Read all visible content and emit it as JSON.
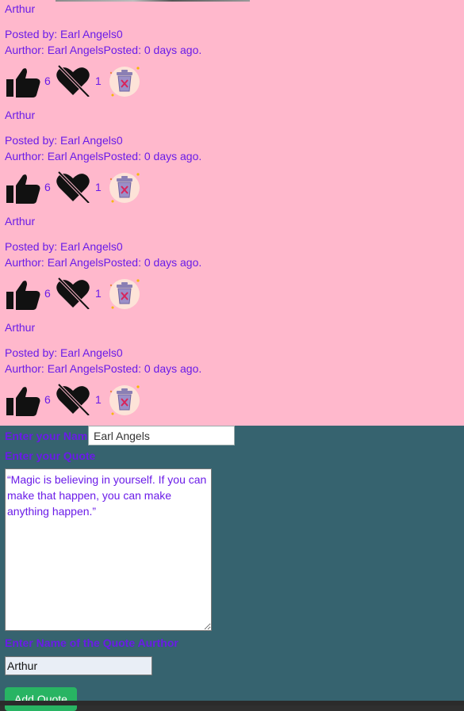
{
  "quotes": [
    {
      "author_label": "Arthur",
      "posted_by": "Posted by: Earl Angels0",
      "meta": "Aurthor: Earl AngelsPosted: 0 days ago.",
      "likes": "6",
      "dislikes": "1"
    },
    {
      "author_label": "Arthur",
      "posted_by": "Posted by: Earl Angels0",
      "meta": "Aurthor: Earl AngelsPosted: 0 days ago.",
      "likes": "6",
      "dislikes": "1"
    },
    {
      "author_label": "Arthur",
      "posted_by": "Posted by: Earl Angels0",
      "meta": "Aurthor: Earl AngelsPosted: 0 days ago.",
      "likes": "6",
      "dislikes": "1"
    },
    {
      "author_label": "Arthur",
      "posted_by": "Posted by: Earl Angels0",
      "meta": "Aurthor: Earl AngelsPosted: 0 days ago.",
      "likes": "6",
      "dislikes": "1"
    }
  ],
  "icons": {
    "like": "thumbs-up-icon",
    "dislike": "heart-off-icon",
    "delete": "trash-icon"
  },
  "form": {
    "name_label": "Enter your Name",
    "name_value": "Earl Angels",
    "quote_label": "Enter your Quote",
    "quote_value": "“Magic is believing in yourself. If you can make that happen, you can make anything happen.”",
    "author_label": "Enter Name of the Quote Aurthor",
    "author_value": "Arthur",
    "submit_label": "Add Quote"
  },
  "colors": {
    "text": "#6a1be8",
    "list_bg": "#ffb8cc",
    "form_bg": "#36636f",
    "button": "#28b463"
  }
}
